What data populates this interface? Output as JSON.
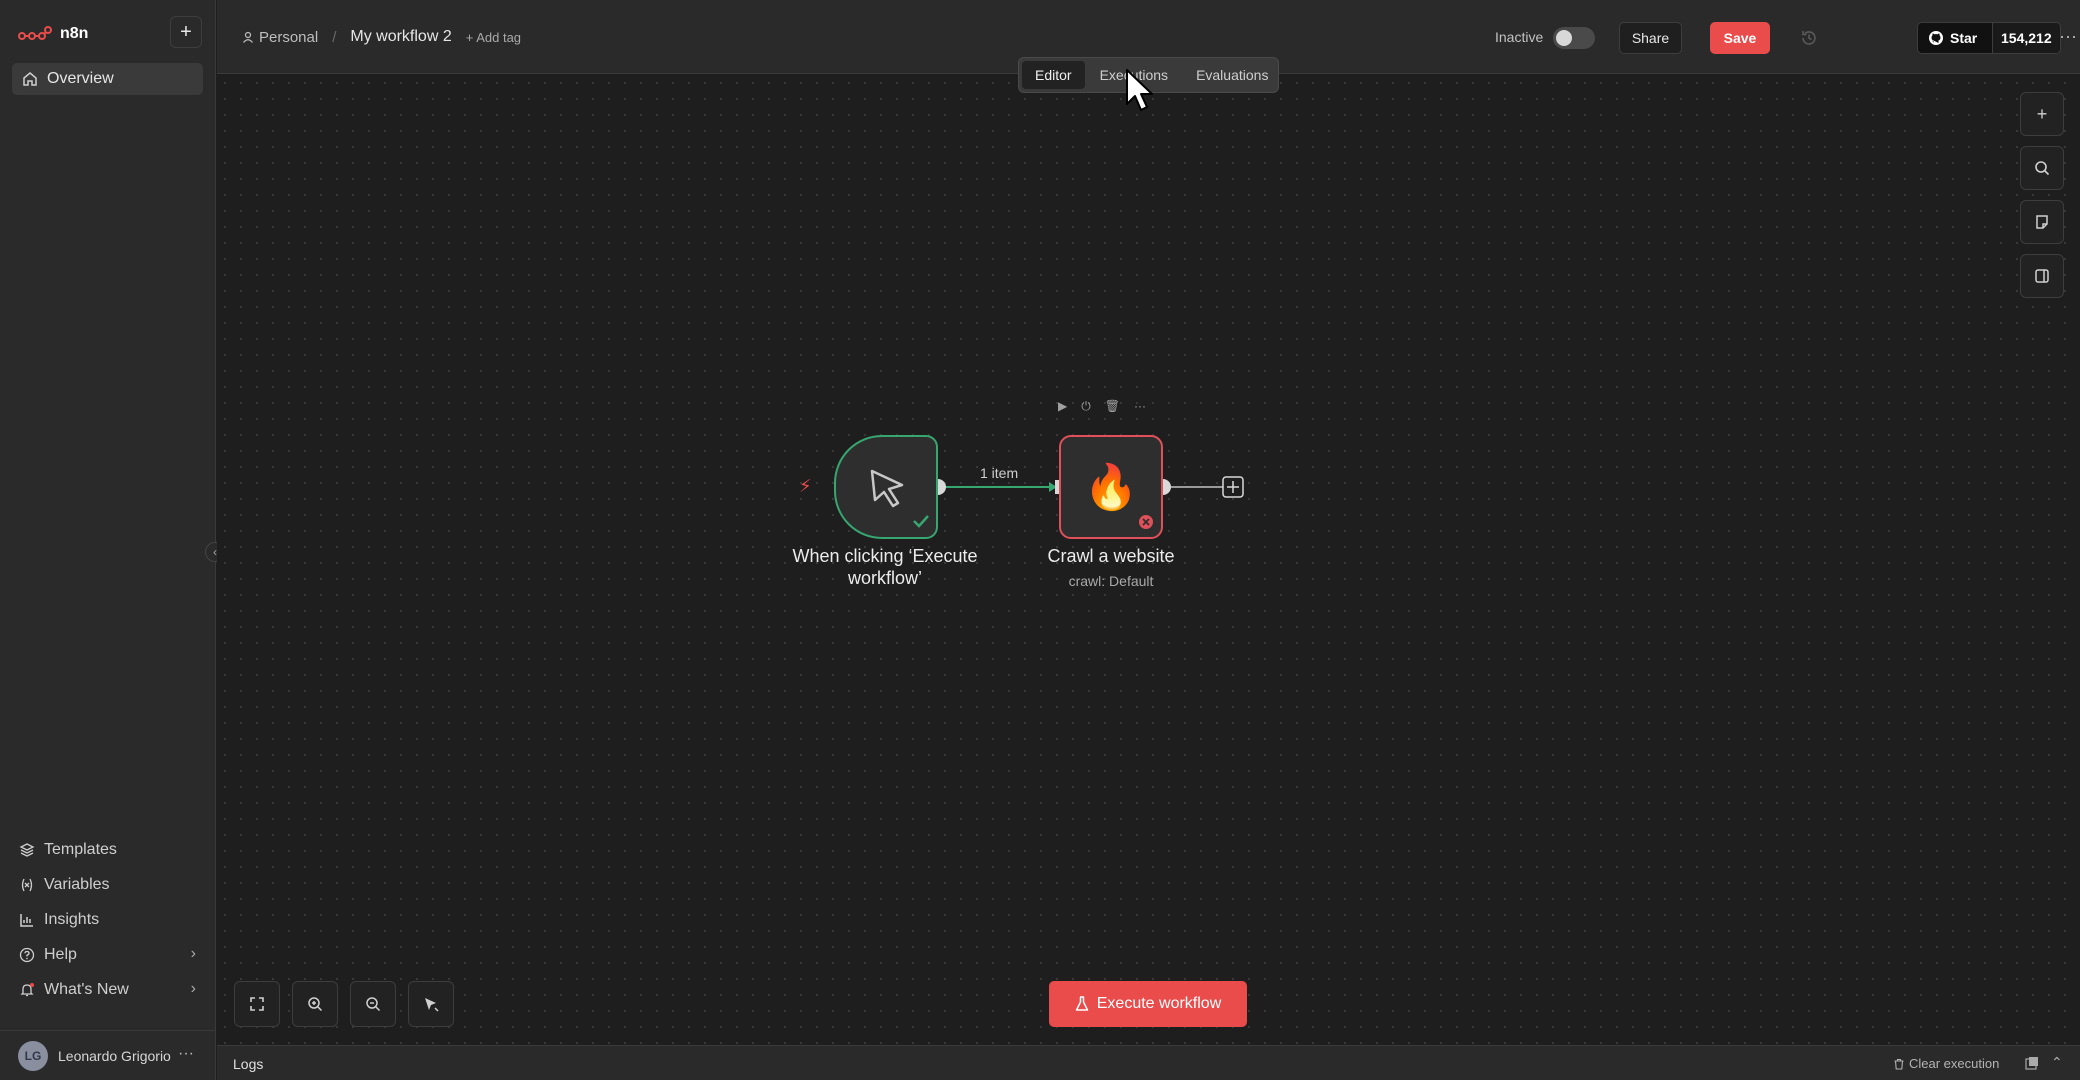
{
  "sidebar": {
    "logo_text": "n8n",
    "overview_label": "Overview",
    "bottom_items": [
      {
        "label": "Templates",
        "icon": "templates-icon"
      },
      {
        "label": "Variables",
        "icon": "variables-icon"
      },
      {
        "label": "Insights",
        "icon": "insights-icon"
      },
      {
        "label": "Help",
        "icon": "help-icon"
      },
      {
        "label": "What's New",
        "icon": "bell-icon"
      }
    ],
    "user": {
      "initials": "LG",
      "name": "Leonardo Grigorio"
    }
  },
  "header": {
    "project": "Personal",
    "workflow_name": "My workflow 2",
    "add_tag": "+ Add tag",
    "status_label": "Inactive",
    "share_label": "Share",
    "save_label": "Save",
    "github_star": "Star",
    "github_count": "154,212"
  },
  "tabs": [
    {
      "label": "Editor",
      "active": true
    },
    {
      "label": "Executions",
      "active": false
    },
    {
      "label": "Evaluations",
      "active": false
    }
  ],
  "canvas": {
    "nodes": [
      {
        "label": "When clicking ‘Execute workflow’",
        "status": "success"
      },
      {
        "label": "Crawl a website",
        "subtitle": "crawl: Default",
        "status": "error"
      }
    ],
    "edge_label": "1 item",
    "execute_label": "Execute workflow"
  },
  "logs": {
    "label": "Logs",
    "clear_label": "Clear execution"
  },
  "colors": {
    "accent": "#ea4b4b",
    "success": "#37a670",
    "error": "#e0505a"
  }
}
